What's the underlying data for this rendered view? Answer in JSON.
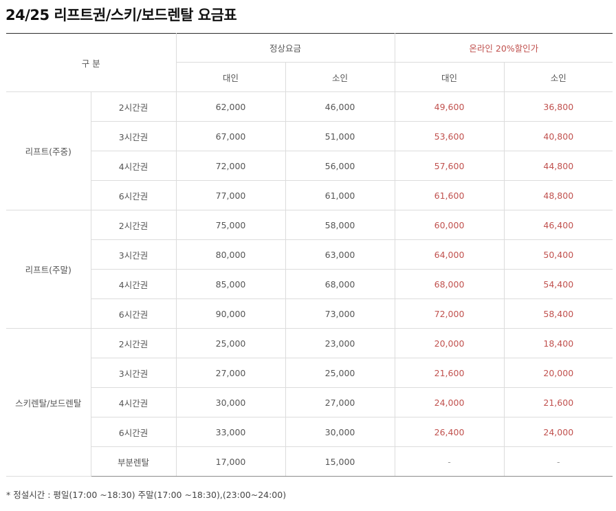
{
  "title": "24/25 리프트권/스키/보드렌탈 요금표",
  "header": {
    "category": "구 분",
    "regular": "정상요금",
    "online": "온라인 20%할인가",
    "adult": "대인",
    "child": "소인"
  },
  "groups": [
    {
      "label": "리프트(주중)",
      "rows": [
        {
          "ticket": "2시간권",
          "regular_adult": "62,000",
          "regular_child": "46,000",
          "online_adult": "49,600",
          "online_child": "36,800"
        },
        {
          "ticket": "3시간권",
          "regular_adult": "67,000",
          "regular_child": "51,000",
          "online_adult": "53,600",
          "online_child": "40,800"
        },
        {
          "ticket": "4시간권",
          "regular_adult": "72,000",
          "regular_child": "56,000",
          "online_adult": "57,600",
          "online_child": "44,800"
        },
        {
          "ticket": "6시간권",
          "regular_adult": "77,000",
          "regular_child": "61,000",
          "online_adult": "61,600",
          "online_child": "48,800"
        }
      ]
    },
    {
      "label": "리프트(주말)",
      "rows": [
        {
          "ticket": "2시간권",
          "regular_adult": "75,000",
          "regular_child": "58,000",
          "online_adult": "60,000",
          "online_child": "46,400"
        },
        {
          "ticket": "3시간권",
          "regular_adult": "80,000",
          "regular_child": "63,000",
          "online_adult": "64,000",
          "online_child": "50,400"
        },
        {
          "ticket": "4시간권",
          "regular_adult": "85,000",
          "regular_child": "68,000",
          "online_adult": "68,000",
          "online_child": "54,400"
        },
        {
          "ticket": "6시간권",
          "regular_adult": "90,000",
          "regular_child": "73,000",
          "online_adult": "72,000",
          "online_child": "58,400"
        }
      ]
    },
    {
      "label": "스키렌탈/보드렌탈",
      "rows": [
        {
          "ticket": "2시간권",
          "regular_adult": "25,000",
          "regular_child": "23,000",
          "online_adult": "20,000",
          "online_child": "18,400"
        },
        {
          "ticket": "3시간권",
          "regular_adult": "27,000",
          "regular_child": "25,000",
          "online_adult": "21,600",
          "online_child": "20,000"
        },
        {
          "ticket": "4시간권",
          "regular_adult": "30,000",
          "regular_child": "27,000",
          "online_adult": "24,000",
          "online_child": "21,600"
        },
        {
          "ticket": "6시간권",
          "regular_adult": "33,000",
          "regular_child": "30,000",
          "online_adult": "26,400",
          "online_child": "24,000"
        },
        {
          "ticket": "부분렌탈",
          "regular_adult": "17,000",
          "regular_child": "15,000",
          "online_adult": "-",
          "online_child": "-"
        }
      ]
    }
  ],
  "note": "* 정설시간 : 평일(17:00 ~18:30) 주말(17:00 ~18:30),(23:00~24:00)",
  "colors": {
    "discount": "#c0504d",
    "top_rule": "#2a2a2a",
    "grid": "#dcdcdc"
  }
}
